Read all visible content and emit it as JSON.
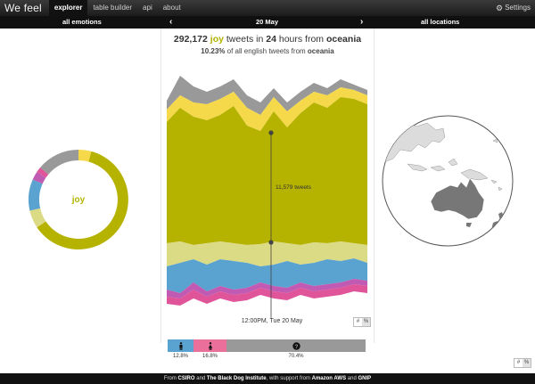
{
  "app": {
    "brand": "We feel"
  },
  "nav": [
    {
      "label": "explorer",
      "active": true
    },
    {
      "label": "table builder",
      "active": false
    },
    {
      "label": "api",
      "active": false
    },
    {
      "label": "about",
      "active": false
    }
  ],
  "settings_label": "Settings",
  "filters": {
    "emotion": "all emotions",
    "date": "20 May",
    "location": "all locations"
  },
  "headline": {
    "count": "292,172",
    "emotion": "joy",
    "middle1": "tweets in",
    "hours": "24",
    "middle2": "hours from",
    "place": "oceania"
  },
  "subline": {
    "percent": "10.23%",
    "text": "of all english tweets from",
    "place": "oceania"
  },
  "chart": {
    "hover_label": "11,579 tweets",
    "time_label": "12:00PM, Tue 20 May",
    "toggle": [
      "#",
      "%"
    ]
  },
  "gender": {
    "male": {
      "icon": "male-icon",
      "percent": "12.8%"
    },
    "female": {
      "icon": "female-icon",
      "percent": "16.8%"
    },
    "unknown": {
      "icon": "question-icon",
      "percent": "70.4%"
    }
  },
  "donut": {
    "label": "joy"
  },
  "colors": {
    "joy": "#b5b300",
    "love": "#f5d94a",
    "other": "#999999",
    "surprise": "#dcdb85",
    "sadness": "#5aa2cf",
    "fear": "#c05ab2",
    "anger": "#e0559a",
    "male": "#5aa2cf",
    "female": "#ea6f9b"
  },
  "footer": {
    "pre": "From",
    "org1": "CSIRO",
    "and": "and",
    "org2": "The Black Dog Institute",
    "mid": ", with support from",
    "org3": "Amazon AWS",
    "and2": "and",
    "org4": "GNIP"
  }
}
